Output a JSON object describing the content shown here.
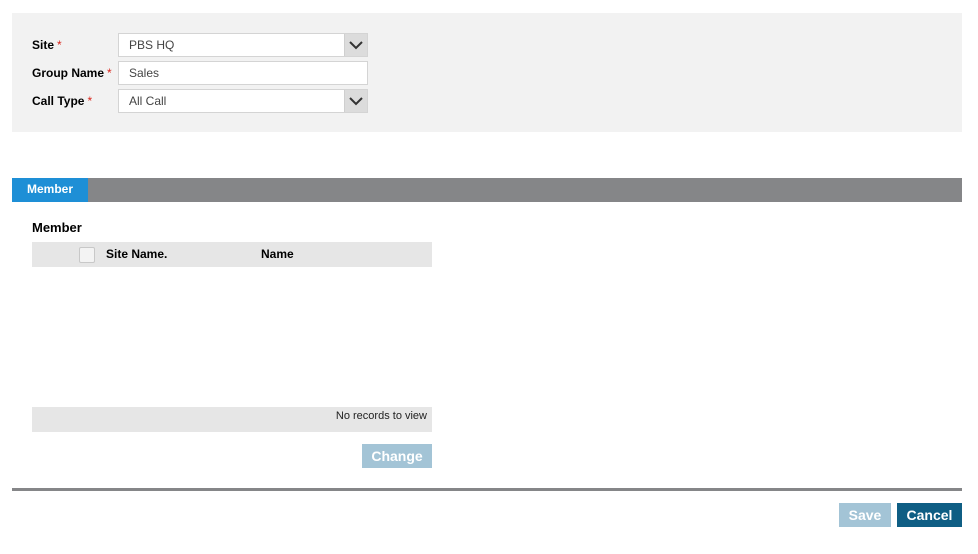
{
  "form": {
    "site": {
      "label": "Site",
      "required_mark": "*",
      "value": "PBS HQ"
    },
    "group_name": {
      "label": "Group Name",
      "required_mark": "*",
      "value": "Sales"
    },
    "call_type": {
      "label": "Call Type",
      "required_mark": "*",
      "value": "All Call"
    }
  },
  "tabs": [
    {
      "label": "Member",
      "active": true
    }
  ],
  "member_section": {
    "title": "Member",
    "columns": [
      "Site Name.",
      "Name"
    ],
    "rows": [],
    "empty_text": "No records to view",
    "change_label": "Change"
  },
  "actions": {
    "save_label": "Save",
    "cancel_label": "Cancel"
  },
  "colors": {
    "tab_active": "#1e8fd6",
    "tab_bar": "#858688",
    "button_disabled": "#a3c4d6",
    "button_primary": "#0f5e84",
    "required": "#d9261c"
  },
  "icons": {
    "select_arrow": "chevron-down-icon"
  }
}
